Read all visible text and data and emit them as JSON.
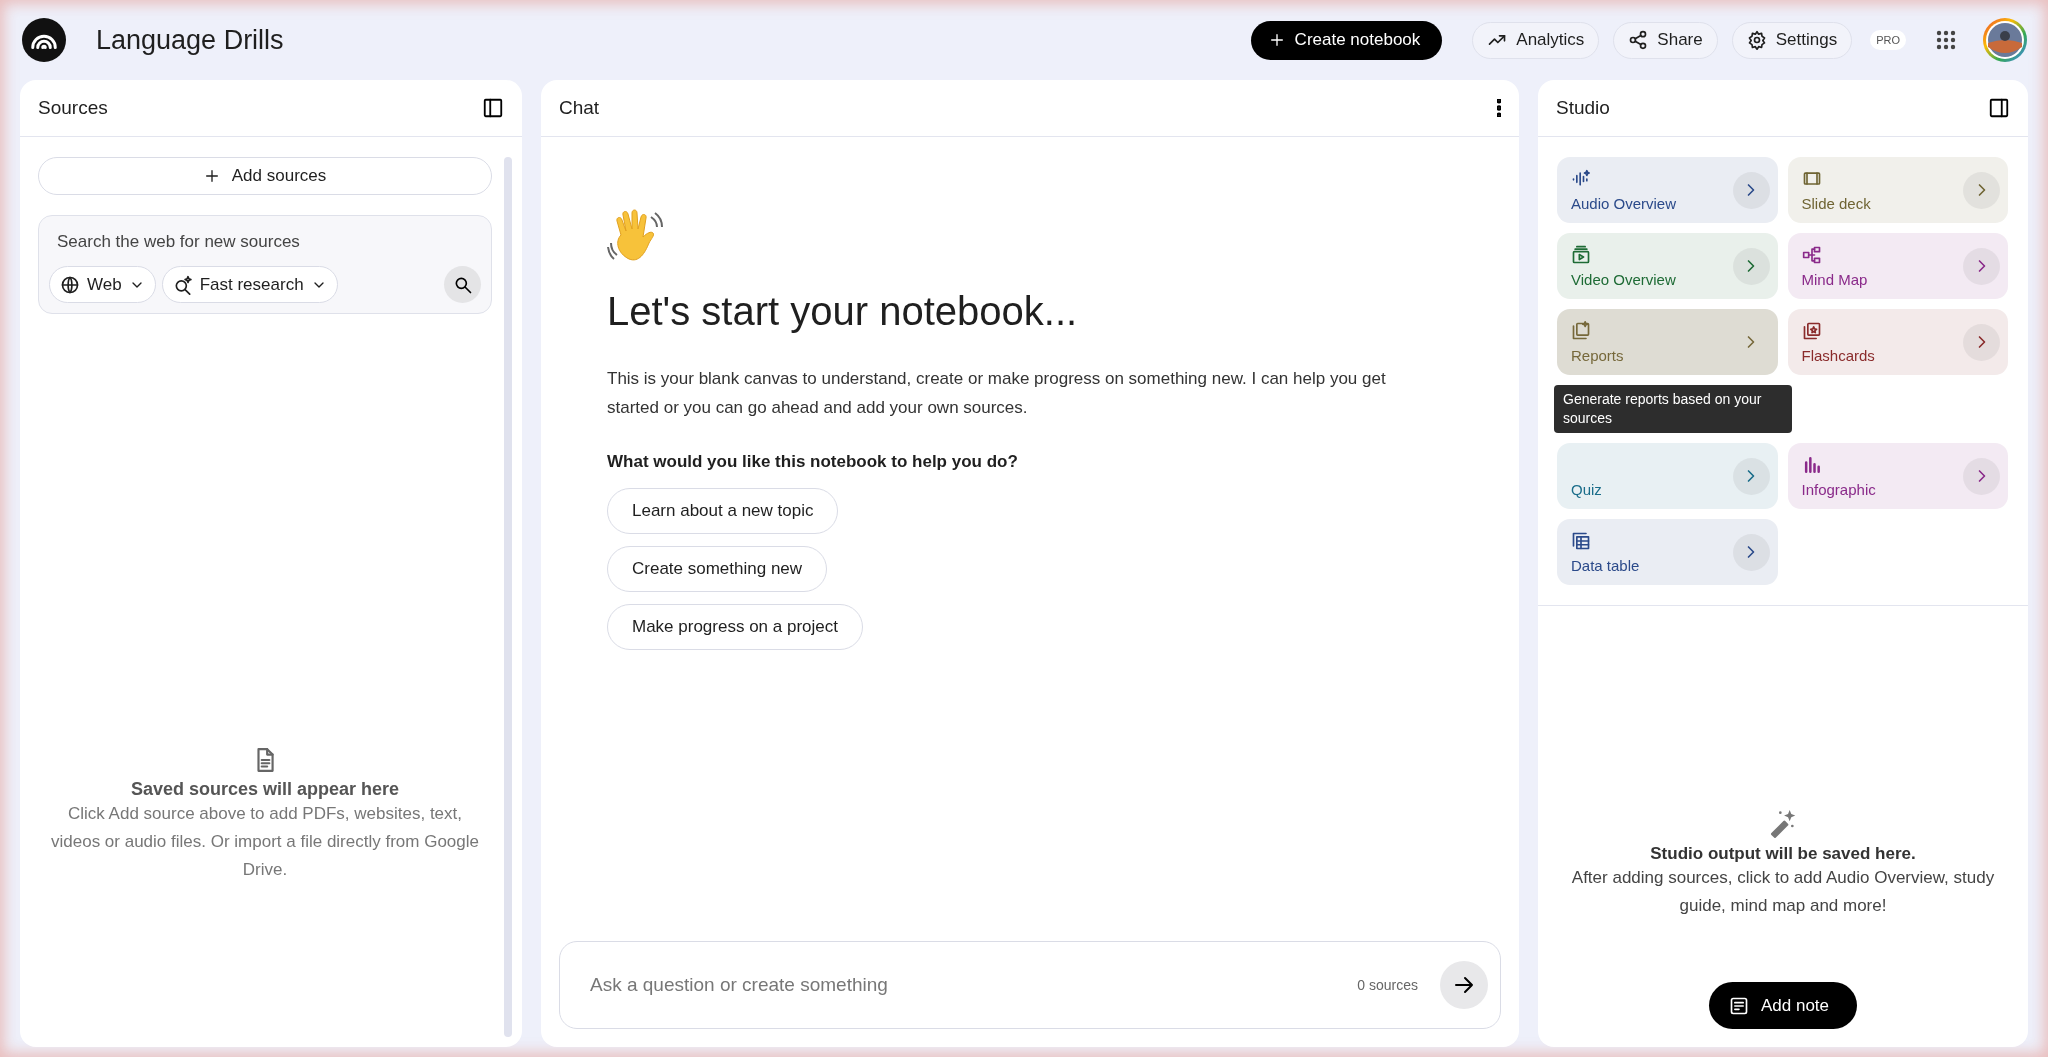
{
  "header": {
    "title": "Language Drills",
    "create_button": "Create notebook",
    "actions": [
      {
        "label": "Analytics",
        "kind": "analytics"
      },
      {
        "label": "Share",
        "kind": "share"
      },
      {
        "label": "Settings",
        "kind": "settings"
      }
    ],
    "plan_badge": "PRO"
  },
  "sources": {
    "title": "Sources",
    "add_button": "Add sources",
    "search": {
      "placeholder": "Search the web for new sources",
      "chips": [
        {
          "label": "Web",
          "kind": "web"
        },
        {
          "label": "Fast research",
          "kind": "research"
        }
      ]
    },
    "empty_title": "Saved sources will appear here",
    "empty_text": "Click Add source above to add PDFs, websites, text, videos or audio files. Or import a file directly from Google Drive."
  },
  "chat": {
    "title": "Chat",
    "heading": "Let's start your notebook...",
    "intro": "This is your blank canvas to understand, create or make progress on something new. I can help you get started or you can go ahead and add your own sources.",
    "question": "What would you like this notebook to help you do?",
    "suggestions": [
      "Learn about a new topic",
      "Create something new",
      "Make progress on a project"
    ],
    "input": {
      "placeholder": "Ask a question or create something",
      "source_count": "0 sources"
    }
  },
  "studio": {
    "title": "Studio",
    "tools": [
      {
        "label": "Audio Overview",
        "kind": "audio",
        "color": "#2b4a8a",
        "hovered": false
      },
      {
        "label": "Slide deck",
        "kind": "slides",
        "color": "#6f6433",
        "hovered": false
      },
      {
        "label": "Video Overview",
        "kind": "video",
        "color": "#1e6b35",
        "hovered": false
      },
      {
        "label": "Mind Map",
        "kind": "mindmap",
        "color": "#8a2a8a",
        "hovered": false
      },
      {
        "label": "Reports",
        "kind": "reports",
        "color": "#76683a",
        "hovered": true
      },
      {
        "label": "Flashcards",
        "kind": "flashcards",
        "color": "#8a2b2b",
        "hovered": false
      },
      {
        "label": "Quiz",
        "kind": "quiz",
        "color": "#1a6d8a",
        "hovered": false
      },
      {
        "label": "Infographic",
        "kind": "infographic",
        "color": "#8a2a8a",
        "hovered": false
      },
      {
        "label": "Data table",
        "kind": "table",
        "color": "#2b4a8a",
        "hovered": false
      }
    ],
    "tooltip": "Generate reports based on your sources",
    "empty_title": "Studio output will be saved here.",
    "empty_text": "After adding sources, click to add Audio Overview, study guide, mind map and more!",
    "add_note_button": "Add note"
  }
}
